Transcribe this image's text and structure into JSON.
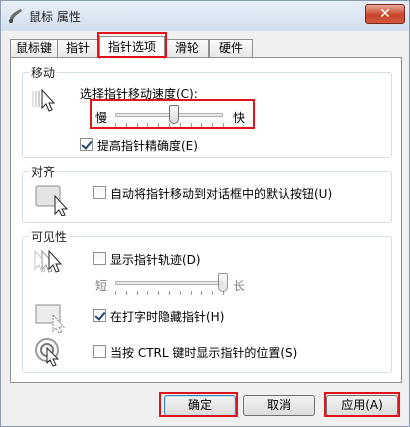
{
  "window": {
    "title": "鼠标 属性",
    "close_glyph": "✕"
  },
  "tabs": [
    {
      "label": "鼠标键"
    },
    {
      "label": "指针"
    },
    {
      "label": "指针选项",
      "active": true
    },
    {
      "label": "滑轮"
    },
    {
      "label": "硬件"
    }
  ],
  "motion": {
    "group_title": "移动",
    "speed_label": "选择指针移动速度(C):",
    "slow_label": "慢",
    "fast_label": "快",
    "speed_fraction": 0.55,
    "precision_label": "提高指针精确度(E)",
    "precision_checked": true
  },
  "snap": {
    "group_title": "对齐",
    "snap_label": "自动将指针移动到对话框中的默认按钮(U)",
    "snap_checked": false
  },
  "visibility": {
    "group_title": "可见性",
    "trails_label": "显示指针轨迹(D)",
    "trails_checked": false,
    "short_label": "短",
    "long_label": "长",
    "trail_fraction": 1.0,
    "hide_label": "在打字时隐藏指针(H)",
    "hide_checked": true,
    "locate_label": "当按 CTRL 键时显示指针的位置(S)",
    "locate_checked": false
  },
  "buttons": {
    "ok": "确定",
    "cancel": "取消",
    "apply": "应用(A)"
  },
  "colors": {
    "highlight": "#e0151b"
  }
}
